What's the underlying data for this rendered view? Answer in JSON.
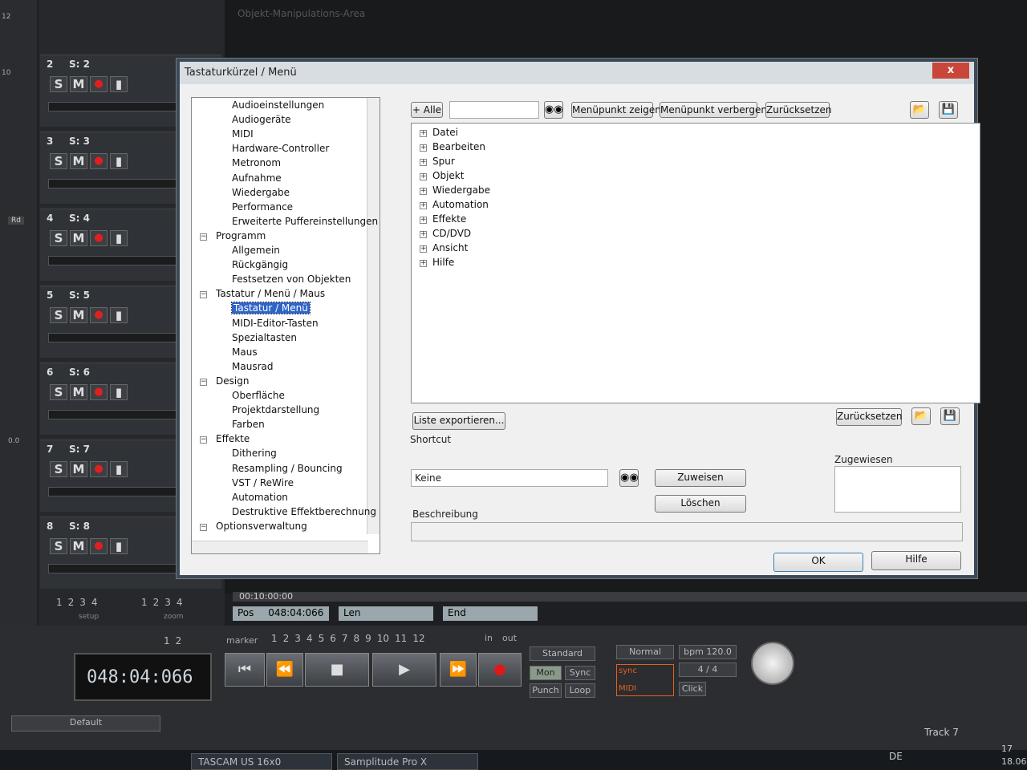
{
  "dialog": {
    "title": "Tastaturkürzel / Menü",
    "close": "x"
  },
  "tree": [
    {
      "label": "Audioeinstellungen",
      "level": 2
    },
    {
      "label": "Audiogeräte",
      "level": 2
    },
    {
      "label": "MIDI",
      "level": 2
    },
    {
      "label": "Hardware-Controller",
      "level": 2
    },
    {
      "label": "Metronom",
      "level": 2
    },
    {
      "label": "Aufnahme",
      "level": 2
    },
    {
      "label": "Wiedergabe",
      "level": 2
    },
    {
      "label": "Performance",
      "level": 2
    },
    {
      "label": "Erweiterte Puffereinstellungen",
      "level": 2
    },
    {
      "label": "Programm",
      "level": 1
    },
    {
      "label": "Allgemein",
      "level": 2
    },
    {
      "label": "Rückgängig",
      "level": 2
    },
    {
      "label": "Festsetzen von Objekten",
      "level": 2
    },
    {
      "label": "Tastatur / Menü / Maus",
      "level": 1
    },
    {
      "label": "Tastatur / Menü",
      "level": 2,
      "selected": true
    },
    {
      "label": "MIDI-Editor-Tasten",
      "level": 2
    },
    {
      "label": "Spezialtasten",
      "level": 2
    },
    {
      "label": "Maus",
      "level": 2
    },
    {
      "label": "Mausrad",
      "level": 2
    },
    {
      "label": "Design",
      "level": 1
    },
    {
      "label": "Oberfläche",
      "level": 2
    },
    {
      "label": "Projektdarstellung",
      "level": 2
    },
    {
      "label": "Farben",
      "level": 2
    },
    {
      "label": "Effekte",
      "level": 1
    },
    {
      "label": "Dithering",
      "level": 2
    },
    {
      "label": "Resampling / Bouncing",
      "level": 2
    },
    {
      "label": "VST / ReWire",
      "level": 2
    },
    {
      "label": "Automation",
      "level": 2
    },
    {
      "label": "Destruktive Effektberechnung",
      "level": 2
    },
    {
      "label": "Optionsverwaltung",
      "level": 1
    }
  ],
  "toolbar": {
    "alle": "+ Alle",
    "show": "Menüpunkt zeigen",
    "hide": "Menüpunkt verbergen",
    "reset": "Zurücksetzen"
  },
  "menu_items": [
    "Datei",
    "Bearbeiten",
    "Spur",
    "Objekt",
    "Wiedergabe",
    "Automation",
    "Effekte",
    "CD/DVD",
    "Ansicht",
    "Hilfe"
  ],
  "export": "Liste exportieren...",
  "reset2": "Zurücksetzen",
  "shortcut": {
    "label": "Shortcut",
    "value": "Keine",
    "assign": "Zuweisen",
    "delete": "Löschen"
  },
  "assigned_label": "Zugewiesen",
  "description_label": "Beschreibung",
  "ok": "OK",
  "help": "Hilfe",
  "tracks": [
    {
      "num": "2",
      "name": "S: 2"
    },
    {
      "num": "3",
      "name": "S: 3"
    },
    {
      "num": "4",
      "name": "S: 4"
    },
    {
      "num": "5",
      "name": "S: 5"
    },
    {
      "num": "6",
      "name": "S: 6"
    },
    {
      "num": "7",
      "name": "S: 7"
    },
    {
      "num": "8",
      "name": "S: 8"
    }
  ],
  "transport": {
    "time": "048:04:066",
    "pos_label": "Pos",
    "pos": "048:04:066",
    "len": "Len",
    "end": "End",
    "marker": "marker",
    "timecode": "00:10:00:00",
    "standard": "Standard",
    "normal": "Normal",
    "bpm_label": "bpm",
    "bpm": "120.0",
    "sig": "4 / 4",
    "default": "Default",
    "track": "Track 7",
    "mon": "Mon",
    "sync": "Sync",
    "punch": "Punch",
    "loop": "Loop",
    "click": "Click",
    "setup": "setup",
    "zoom": "zoom",
    "in": "in",
    "out": "out"
  },
  "taskbar": {
    "lang": "DE",
    "t1": "TASCAM US 16x0",
    "t2": "Samplitude Pro X",
    "time": "17",
    "date": "18.06"
  }
}
